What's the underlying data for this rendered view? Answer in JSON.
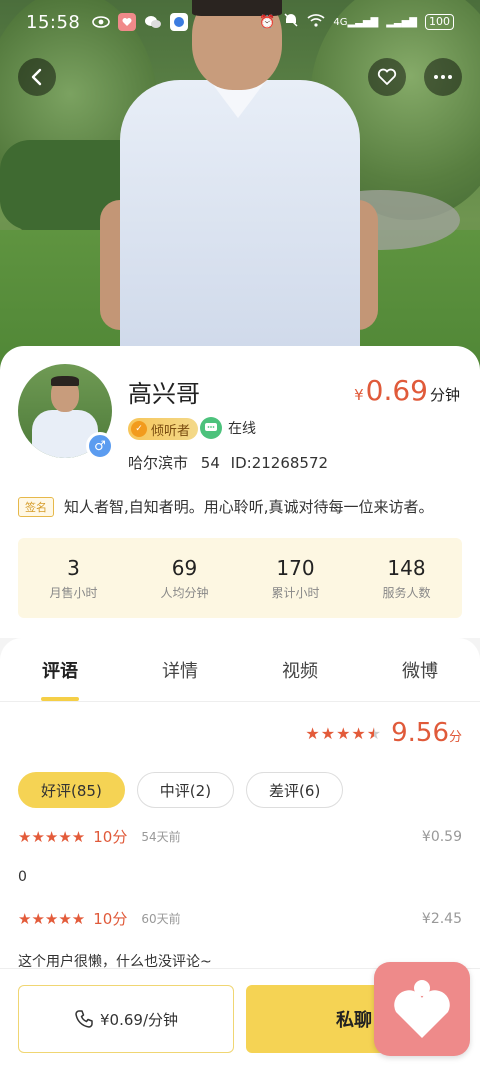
{
  "status_bar": {
    "time": "15:58",
    "network": "4G",
    "battery": "100"
  },
  "header": {
    "back_icon": "chevron-left-icon",
    "favorite_icon": "heart-outline-icon",
    "more_icon": "more-dots-icon"
  },
  "profile": {
    "name": "高兴哥",
    "gender": "male",
    "listener_badge": "倾听者",
    "online_status": "在线",
    "location": "哈尔滨市",
    "age": "54",
    "id_label": "ID:21268572",
    "price": {
      "currency": "¥",
      "value": "0.69",
      "unit": "分钟"
    },
    "signature_tag": "签名",
    "signature": "知人者智,自知者明。用心聆听,真诚对待每一位来访者。",
    "stats": [
      {
        "value": "3",
        "label": "月售小时"
      },
      {
        "value": "69",
        "label": "人均分钟"
      },
      {
        "value": "170",
        "label": "累计小时"
      },
      {
        "value": "148",
        "label": "服务人数"
      }
    ]
  },
  "tabs": [
    {
      "label": "评语",
      "active": true
    },
    {
      "label": "详情",
      "active": false
    },
    {
      "label": "视频",
      "active": false
    },
    {
      "label": "微博",
      "active": false
    }
  ],
  "rating": {
    "score": "9.56",
    "unit": "分",
    "stars": 4.5
  },
  "filters": [
    {
      "label": "好评(85)",
      "active": true
    },
    {
      "label": "中评(2)",
      "active": false
    },
    {
      "label": "差评(6)",
      "active": false
    }
  ],
  "reviews": [
    {
      "score": "10分",
      "days": "54天前",
      "amount": "¥0.59",
      "text": "0"
    },
    {
      "score": "10分",
      "days": "60天前",
      "amount": "¥2.45",
      "text": "这个用户很懒，什么也没评论~"
    }
  ],
  "bottom": {
    "call_label": "¥0.69/分钟",
    "chat_label": "私聊"
  },
  "colors": {
    "accent_yellow": "#f5d354",
    "price_red": "#e05a3a",
    "online_green": "#4cc27c",
    "gender_blue": "#5b9cf0",
    "float_pink": "#ee8a8a"
  }
}
